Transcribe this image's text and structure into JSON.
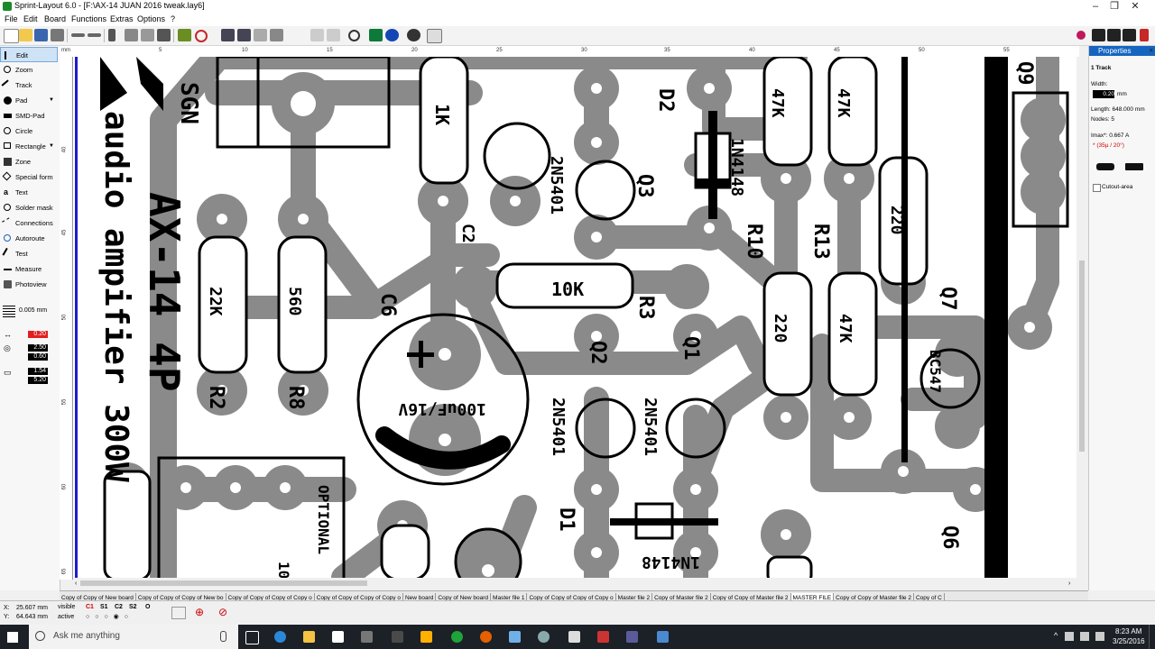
{
  "window": {
    "title": "Sprint-Layout 6.0 - [F:\\AX-14 JUAN 2016 tweak.lay6]"
  },
  "menu": [
    "File",
    "Edit",
    "Board",
    "Functions",
    "Extras",
    "Options",
    "?"
  ],
  "tools": [
    {
      "label": "Edit",
      "icon": "pointer-icon"
    },
    {
      "label": "Zoom",
      "icon": "zoom-icon"
    },
    {
      "label": "Track",
      "icon": "track-icon"
    },
    {
      "label": "Pad",
      "icon": "pad-icon"
    },
    {
      "label": "SMD-Pad",
      "icon": "smd-pad-icon"
    },
    {
      "label": "Circle",
      "icon": "circle-icon"
    },
    {
      "label": "Rectangle",
      "icon": "rectangle-icon"
    },
    {
      "label": "Zone",
      "icon": "zone-icon"
    },
    {
      "label": "Special form",
      "icon": "special-form-icon"
    },
    {
      "label": "Text",
      "icon": "text-icon"
    },
    {
      "label": "Solder mask",
      "icon": "solder-mask-icon"
    },
    {
      "label": "Connections",
      "icon": "connections-icon"
    },
    {
      "label": "Autoroute",
      "icon": "autoroute-icon"
    },
    {
      "label": "Test",
      "icon": "test-icon"
    },
    {
      "label": "Measure",
      "icon": "measure-icon"
    },
    {
      "label": "Photoview",
      "icon": "photoview-icon"
    }
  ],
  "grid": "0.005 mm",
  "values": {
    "track_width": "0.20",
    "pad_outer": "2.50",
    "pad_inner": "0.60",
    "smd_w": "1.54",
    "smd_h": "5.20"
  },
  "ruler": {
    "h": [
      "mm",
      "5",
      "10",
      "15",
      "20",
      "25",
      "30",
      "35",
      "40",
      "45",
      "50",
      "55"
    ],
    "v": [
      "40",
      "45",
      "50",
      "55",
      "60",
      "65"
    ]
  },
  "properties": {
    "header": "Properties",
    "item": "1 Track",
    "width_label": "Width:",
    "width_value": "0.20",
    "width_unit": "mm",
    "length": "Length: 648.000 mm",
    "nodes": "Nodes: 5",
    "imax": "Imax*: 0.667 A",
    "imax_note": "* (35µ / 20°)",
    "cutout": "Cutout-area"
  },
  "pcb_labels": {
    "sgn": "SGN",
    "d2": "D2",
    "d2_part": "1N4148",
    "r1k": "1K",
    "cap2n": "2N5401",
    "q3": "Q3",
    "c2": "C2",
    "r47a": "47K",
    "r47b": "47K",
    "r10": "R10",
    "r13": "R13",
    "r220a": "220",
    "r220b": "220",
    "r47c": "47K",
    "r10k": "10K",
    "r3": "R3",
    "c6": "C6",
    "r22k": "22K",
    "r560": "560",
    "r2": "R2",
    "r8": "R8",
    "cap": "100uF/16V",
    "q2": "Q2",
    "q1": "Q1",
    "q2p": "2N5401",
    "q1p": "2N5401",
    "q7": "Q7",
    "bc547": "BC547",
    "d1": "D1",
    "d1_part": "1N4148",
    "optional": "OPTIONAL",
    "q6": "Q6",
    "q9": "Q9",
    "ten": "10",
    "title_main": "AX-14 4P",
    "title_sub": "audio ampifier 300W"
  },
  "tabs": [
    "Copy of Copy of New board",
    "Copy of Copy of Copy of New bo",
    "Copy of Copy of Copy of Copy o",
    "Copy of Copy of Copy of Copy o",
    "New board",
    "Copy of New board",
    "Master file 1",
    "Copy of Copy of Copy of Copy o",
    "Master file 2",
    "Copy of Master file 2",
    "Copy of Copy of Master file 2",
    "MASTER FILE",
    "Copy of Copy of Master file 2",
    "Copy of C"
  ],
  "status": {
    "x": "25.607 mm",
    "y": "64.643 mm",
    "visible": "visible",
    "active": "active",
    "layers": [
      "C1",
      "S1",
      "C2",
      "S2",
      "O"
    ]
  },
  "taskbar": {
    "search": "Ask me anything",
    "time": "8:23 AM",
    "date": "3/25/2016"
  },
  "colors": {
    "pcb_bg": "#ffffff",
    "copper": "#8a8a8a",
    "silk": "#000000",
    "accent": "#1565c0"
  }
}
